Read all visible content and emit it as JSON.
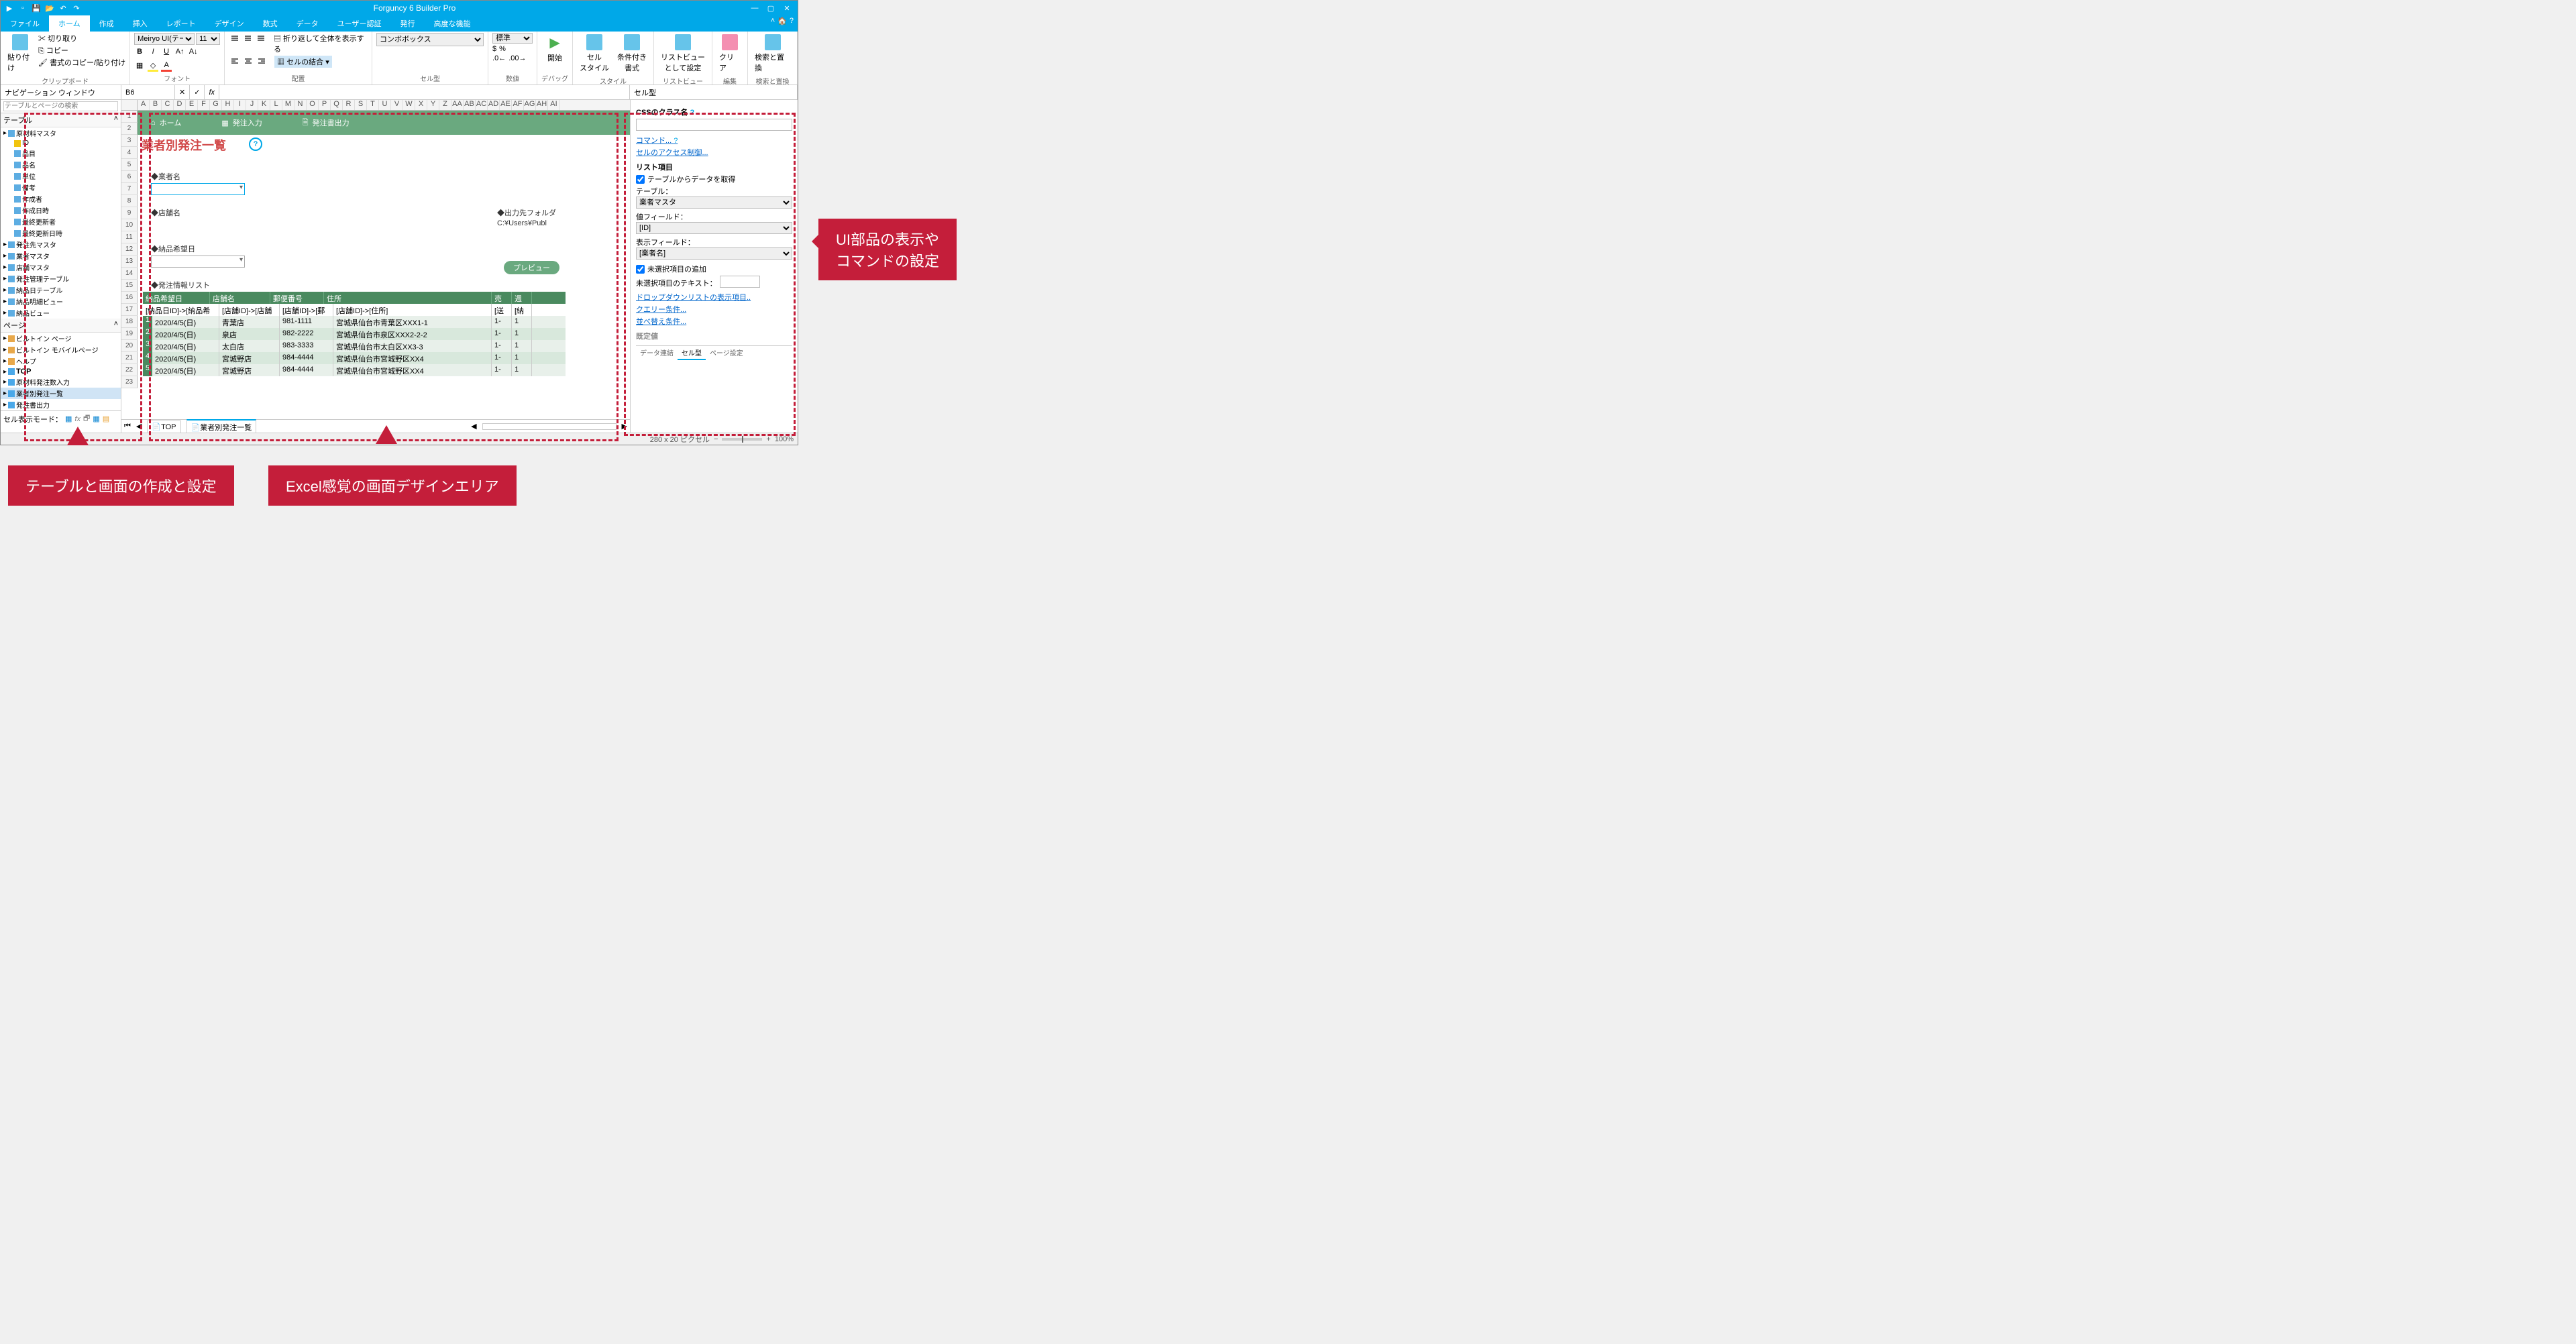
{
  "app": {
    "title": "Forguncy 6 Builder Pro"
  },
  "menu": {
    "file": "ファイル",
    "home": "ホーム",
    "create": "作成",
    "insert": "挿入",
    "report": "レポート",
    "design": "デザイン",
    "formula": "数式",
    "data": "データ",
    "auth": "ユーザー認証",
    "publish": "発行",
    "advanced": "高度な機能"
  },
  "ribbon": {
    "clipboard": {
      "label": "クリップボード",
      "paste": "貼り付け",
      "cut": "切り取り",
      "copy": "コピー",
      "formatcopy": "書式のコピー/貼り付け"
    },
    "font": {
      "label": "フォント",
      "name": "Meiryo UI(テー",
      "size": "11"
    },
    "align": {
      "label": "配置",
      "wrap": "折り返して全体を表示する",
      "merge": "セルの結合"
    },
    "celltype": {
      "label": "セル型",
      "combo": "コンボボックス"
    },
    "number": {
      "label": "数値",
      "fmt": "標準"
    },
    "debug": {
      "start": "開始",
      "label": "デバッグ"
    },
    "style": {
      "cellstyle": "セル\nスタイル",
      "cond": "条件付き\n書式",
      "label": "スタイル"
    },
    "listview": {
      "set": "リストビュー\nとして設定",
      "label": "リストビュー"
    },
    "edit": {
      "clear": "クリア",
      "label": "編集"
    },
    "find": {
      "find": "検索と置換",
      "label": "検索と置換"
    }
  },
  "nav": {
    "title": "ナビゲーション ウィンドウ",
    "search_ph": "テーブルとページの検索",
    "tables": "テーブル",
    "pages": "ページ",
    "tree": [
      {
        "l": 1,
        "t": "原材料マスタ",
        "i": "tico"
      },
      {
        "l": 2,
        "t": "ID",
        "i": "kico"
      },
      {
        "l": 2,
        "t": "品目",
        "i": "cico"
      },
      {
        "l": 2,
        "t": "品名",
        "i": "cico"
      },
      {
        "l": 2,
        "t": "単位",
        "i": "cico"
      },
      {
        "l": 2,
        "t": "備考",
        "i": "cico"
      },
      {
        "l": 2,
        "t": "作成者",
        "i": "cico"
      },
      {
        "l": 2,
        "t": "作成日時",
        "i": "cico"
      },
      {
        "l": 2,
        "t": "最終更新者",
        "i": "cico"
      },
      {
        "l": 2,
        "t": "最終更新日時",
        "i": "cico"
      },
      {
        "l": 1,
        "t": "発注先マスタ",
        "i": "tico"
      },
      {
        "l": 1,
        "t": "業者マスタ",
        "i": "tico"
      },
      {
        "l": 1,
        "t": "店舗マスタ",
        "i": "tico"
      },
      {
        "l": 1,
        "t": "発注管理テーブル",
        "i": "tico"
      },
      {
        "l": 1,
        "t": "納品日テーブル",
        "i": "tico"
      },
      {
        "l": 1,
        "t": "納品明細ビュー",
        "i": "tico"
      },
      {
        "l": 1,
        "t": "納品ビュー",
        "i": "tico"
      }
    ],
    "ptree": [
      {
        "l": 1,
        "t": "ビルトイン ページ",
        "i": "pico"
      },
      {
        "l": 1,
        "t": "ビルトイン モバイルページ",
        "i": "pico"
      },
      {
        "l": 1,
        "t": "ヘルプ",
        "i": "pico"
      },
      {
        "l": 1,
        "t": "TOP",
        "i": "gico",
        "bold": true
      },
      {
        "l": 1,
        "t": "原材料発注数入力",
        "i": "gico"
      },
      {
        "l": 1,
        "t": "業者別発注一覧",
        "i": "gico",
        "sel": true
      },
      {
        "l": 1,
        "t": "発注書出力",
        "i": "gico"
      }
    ],
    "cellmode": "セル表示モード："
  },
  "formula": {
    "cell": "B6"
  },
  "design": {
    "cols": [
      "A",
      "B",
      "C",
      "D",
      "E",
      "F",
      "G",
      "H",
      "I",
      "J",
      "K",
      "L",
      "M",
      "N",
      "O",
      "P",
      "Q",
      "R",
      "S",
      "T",
      "U",
      "V",
      "W",
      "X",
      "Y",
      "Z",
      "AA",
      "AB",
      "AC",
      "AD",
      "AE",
      "AF",
      "AG",
      "AH",
      "AI"
    ],
    "nav_home": "ホーム",
    "nav_input": "発注入力",
    "nav_output": "発注書出力",
    "page_title": "業者別発注一覧",
    "lbl_vendor": "◆業者名",
    "lbl_store": "◆店舗名",
    "lbl_output": "◆出力先フォルダ",
    "output_val": "C:¥Users¥Publ",
    "lbl_date": "◆納品希望日",
    "btn_preview": "プレビュー",
    "lbl_list": "◆発注情報リスト",
    "headers": [
      "納品希望日",
      "店舗名",
      "郵便番号",
      "住所",
      "売",
      "週"
    ],
    "bindrow": [
      "[納品日ID]->[納品希",
      "[店舗ID]->[店舗",
      "[店舗ID]->[郵",
      "[店舗ID]->[住所]",
      "[送",
      "[納"
    ],
    "rows": [
      [
        "1",
        "2020/4/5(日)",
        "青葉店",
        "981-1111",
        "宮城県仙台市青葉区XXX1-1",
        "1-",
        "1"
      ],
      [
        "2",
        "2020/4/5(日)",
        "泉店",
        "982-2222",
        "宮城県仙台市泉区XXX2-2-2",
        "1-",
        "1"
      ],
      [
        "3",
        "2020/4/5(日)",
        "太白店",
        "983-3333",
        "宮城県仙台市太白区XX3-3",
        "1-",
        "1"
      ],
      [
        "4",
        "2020/4/5(日)",
        "宮城野店",
        "984-4444",
        "宮城県仙台市宮城野区XX4",
        "1-",
        "1"
      ],
      [
        "5",
        "2020/4/5(日)",
        "宮城野店",
        "984-4444",
        "宮城県仙台市宮城野区XX4",
        "1-",
        "1"
      ]
    ],
    "tab_top": "TOP",
    "tab_cur": "業者別発注一覧"
  },
  "right": {
    "title": "セル型",
    "css_label": "CSSのクラス名",
    "cmd": "コマンド...",
    "access": "セルのアクセス制御...",
    "list": "リスト項目",
    "fromtable": "テーブルからデータを取得",
    "table_lbl": "テーブル：",
    "table_val": "業者マスタ",
    "val_lbl": "値フィールド：",
    "val_val": "[ID]",
    "disp_lbl": "表示フィールド：",
    "disp_val": "[業者名]",
    "add_empty": "未選択項目の追加",
    "empty_text": "未選択項目のテキスト：",
    "dropdown_items": "ドロップダウンリストの表示項目..",
    "query": "クエリー条件...",
    "sort": "並べ替え条件...",
    "default": "既定値",
    "tabs": {
      "data": "データ連結",
      "celltype": "セル型",
      "page": "ページ設定"
    }
  },
  "status": {
    "size": "280 x 20 ピクセル",
    "zoom": "100%"
  },
  "callouts": {
    "left": "テーブルと画面の作成と設定",
    "center": "Excel感覚の画面デザインエリア",
    "right": "UI部品の表示や\nコマンドの設定"
  }
}
